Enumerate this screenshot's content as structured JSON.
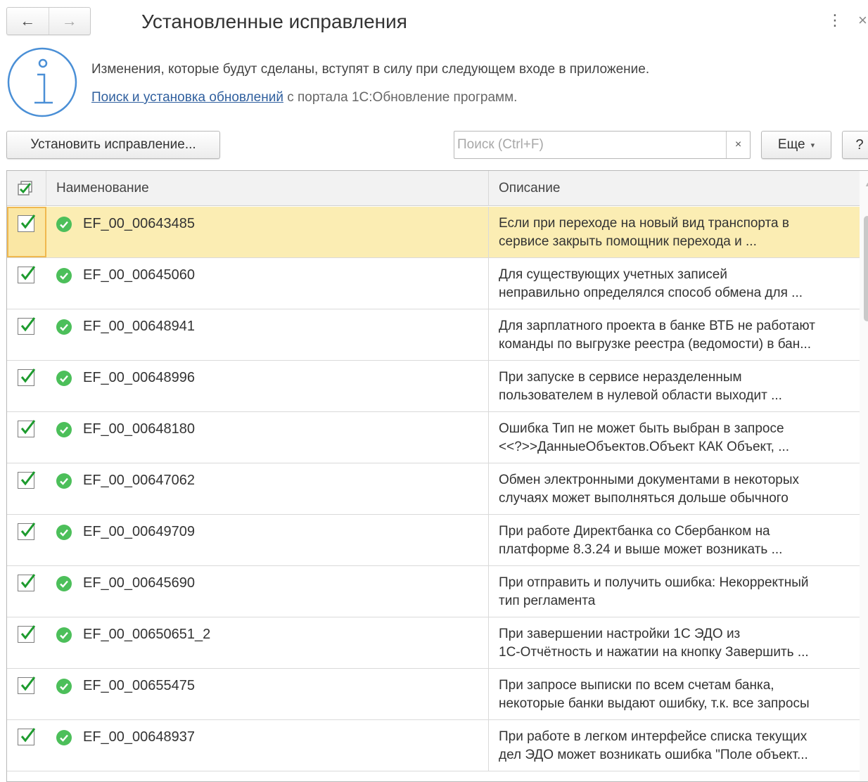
{
  "window": {
    "title": "Установленные исправления",
    "back_icon": "←",
    "forward_icon": "→",
    "more_icon": "⋮",
    "close_icon": "×"
  },
  "info": {
    "line1": "Изменения, которые будут сделаны, вступят в силу при следующем входе в приложение.",
    "link_text": "Поиск и установка обновлений",
    "line2_suffix": " с портала 1С:Обновление программ."
  },
  "toolbar": {
    "install_label": "Установить исправление...",
    "search_placeholder": "Поиск (Ctrl+F)",
    "search_value": "",
    "clear_label": "×",
    "more_label": "Еще",
    "more_caret": "▾",
    "help_label": "?"
  },
  "table": {
    "columns": {
      "name": "Наименование",
      "description": "Описание"
    },
    "rows": [
      {
        "name": "EF_00_00643485",
        "checked": true,
        "selected": true,
        "desc1": "Если при переходе на новый вид транспорта в",
        "desc2": "сервисе закрыть помощник перехода и ..."
      },
      {
        "name": "EF_00_00645060",
        "checked": true,
        "selected": false,
        "desc1": "Для существующих учетных записей",
        "desc2": "неправильно определялся способ обмена для ..."
      },
      {
        "name": "EF_00_00648941",
        "checked": true,
        "selected": false,
        "desc1": "Для зарплатного проекта в банке ВТБ не работают",
        "desc2": "команды по выгрузке реестра (ведомости) в бан..."
      },
      {
        "name": "EF_00_00648996",
        "checked": true,
        "selected": false,
        "desc1": "При запуске в сервисе неразделенным",
        "desc2": "пользователем в нулевой области выходит ..."
      },
      {
        "name": "EF_00_00648180",
        "checked": true,
        "selected": false,
        "desc1": "Ошибка Тип не может быть выбран в запросе",
        "desc2": "<<?>>ДанныеОбъектов.Объект КАК Объект, ..."
      },
      {
        "name": "EF_00_00647062",
        "checked": true,
        "selected": false,
        "desc1": "Обмен электронными документами в некоторых",
        "desc2": "случаях может выполняться дольше обычного"
      },
      {
        "name": "EF_00_00649709",
        "checked": true,
        "selected": false,
        "desc1": "При работе Директбанка со Сбербанком на",
        "desc2": "платформе 8.3.24 и выше может возникать ..."
      },
      {
        "name": "EF_00_00645690",
        "checked": true,
        "selected": false,
        "desc1": "При отправить и получить ошибка: Некорректный",
        "desc2": "тип регламента"
      },
      {
        "name": "EF_00_00650651_2",
        "checked": true,
        "selected": false,
        "desc1": "При завершении настройки 1С ЭДО из",
        "desc2": "1С-Отчётность и нажатии на кнопку Завершить ..."
      },
      {
        "name": "EF_00_00655475",
        "checked": true,
        "selected": false,
        "desc1": "При запросе выписки по всем счетам банка,",
        "desc2": "некоторые банки выдают ошибку, т.к. все запросы"
      },
      {
        "name": "EF_00_00648937",
        "checked": true,
        "selected": false,
        "desc1": "При работе в легком интерфейсе списка текущих",
        "desc2": "дел ЭДО может возникать ошибка \"Поле объект..."
      }
    ]
  },
  "colors": {
    "selected_row": "#fbedb3",
    "selected_cell_border": "#f0b84f",
    "check_green": "#1d9b2e",
    "status_ok": "#4cbf5a",
    "link": "#2f5f9e",
    "info_icon": "#4a8fd6"
  },
  "icons": {
    "info": "info-circle-icon",
    "status": "check-circle-icon",
    "checkbox": "checkbox-checked-icon"
  }
}
